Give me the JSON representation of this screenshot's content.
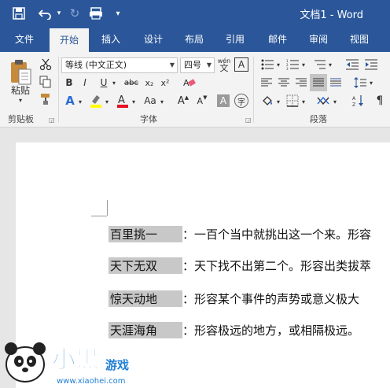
{
  "titlebar": {
    "title": "文档1 - Word",
    "quick_access": [
      {
        "name": "save-icon",
        "glyph": "🖫"
      },
      {
        "name": "undo-icon",
        "glyph": "↶"
      },
      {
        "name": "undo-dropdown-icon",
        "glyph": "▾"
      },
      {
        "name": "redo-icon",
        "glyph": "↻"
      },
      {
        "name": "print-preview-icon",
        "glyph": "⎙"
      },
      {
        "name": "customize-quick-access-icon",
        "glyph": "▾"
      }
    ]
  },
  "tabs": [
    "文件",
    "开始",
    "插入",
    "设计",
    "布局",
    "引用",
    "邮件",
    "审阅",
    "视图"
  ],
  "ribbon": {
    "clipboard": {
      "paste_label": "粘贴",
      "group_label": "剪贴板"
    },
    "font": {
      "font_name": "等线 (中文正文)",
      "font_size": "四号",
      "phonetic_glyph": "wén",
      "border_char_glyph": "A",
      "bold": "B",
      "italic": "I",
      "underline": "U",
      "strikethrough": "abc",
      "subscript": "x₂",
      "superscript": "x²",
      "text_effects": "A",
      "change_case": "Aa",
      "grow_font": "A",
      "shrink_font": "A",
      "char_shading": "A",
      "enclose_char": "字",
      "group_label": "字体"
    },
    "paragraph": {
      "group_label": "段落"
    }
  },
  "document": {
    "lines": [
      {
        "term": "百里挑一",
        "rest": "：一百个当中就挑出这一个来。形容"
      },
      {
        "term": "天下无双",
        "rest": "：天下找不出第二个。形容出类拔萃"
      },
      {
        "term": "惊天动地",
        "rest": "：形容某个事件的声势或意义极大"
      },
      {
        "term": "天涯海角",
        "rest": "：形容极远的地方，或相隔极远。"
      }
    ]
  },
  "watermark": {
    "brand": "小黑游戏",
    "url": "www.xiaohei.com"
  },
  "colors": {
    "word_blue": "#2b579a",
    "ribbon_bg": "#f3f3f3",
    "highlight": "#c8c8c8",
    "highlight_yellow": "#ffff00",
    "font_color_red": "#e81123"
  }
}
